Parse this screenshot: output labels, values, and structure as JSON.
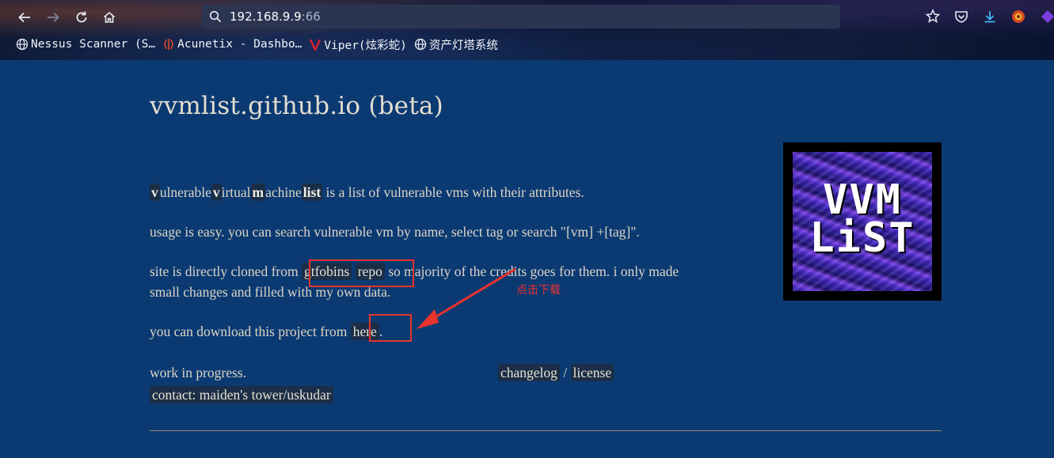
{
  "browser": {
    "url_host": "192.168.9.9",
    "url_port": ":66",
    "bookmarks": [
      {
        "label": "Nessus Scanner (S…"
      },
      {
        "label": "Acunetix - Dashbo…"
      },
      {
        "label": "Viper(炫彩蛇)"
      },
      {
        "label": "资产灯塔系统"
      }
    ]
  },
  "page": {
    "title": "vvmlist.github.io (beta)",
    "intro": {
      "w1_first": "v",
      "w1_rest": "ulnerable",
      "w2_first": "v",
      "w2_rest": "irtual",
      "w3_first": "m",
      "w3_rest": "achine",
      "w4": "list",
      "rest": " is a list of vulnerable vms with their attributes."
    },
    "usage": "usage is easy. you can search vulnerable vm by name, select tag or search \"[vm] +[tag]\".",
    "clone_prefix": "site is directly cloned from ",
    "clone_link1": "gtfobins",
    "clone_link2": "repo",
    "clone_suffix": " so majority of the credits goes for them. i only made",
    "clone_line2": "small changes and filled with my own data.",
    "download_prefix": "you can download this project from ",
    "download_link": "here",
    "download_suffix": ".",
    "wip": "work in progress.",
    "changelog": "changelog",
    "separator": " / ",
    "license": "license",
    "contact": "contact: maiden's tower/uskudar",
    "logo_line1": "VVM",
    "logo_line2": "LiST"
  },
  "annotation": {
    "text": "点击下载",
    "color": "#e8332c"
  }
}
